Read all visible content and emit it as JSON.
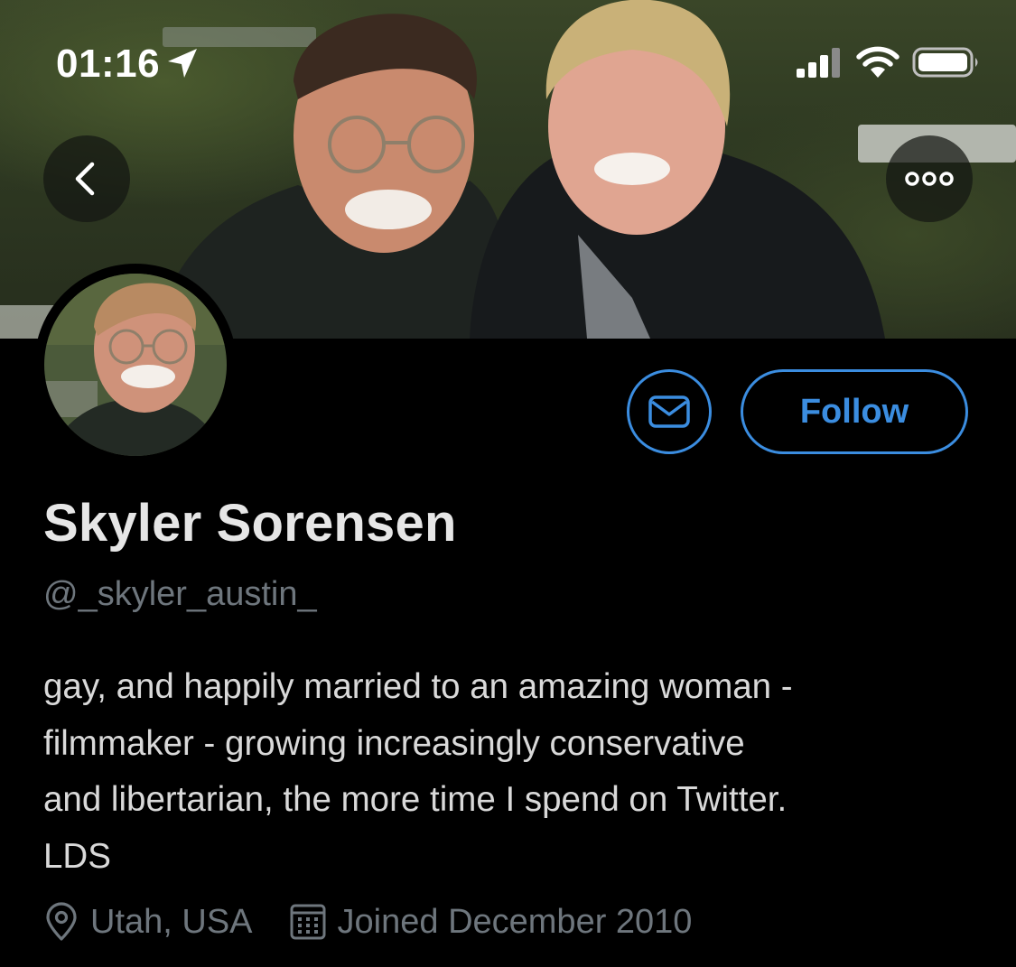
{
  "status_bar": {
    "time": "01:16",
    "location_icon": "location-arrow-icon",
    "signal_icon": "cellular-signal-icon",
    "wifi_icon": "wifi-icon",
    "battery_icon": "battery-icon"
  },
  "header": {
    "back_icon": "chevron-left-icon",
    "more_icon": "more-horizontal-icon"
  },
  "actions": {
    "message_icon": "envelope-icon",
    "follow_label": "Follow"
  },
  "profile": {
    "display_name": "Skyler Sorensen",
    "handle": "@_skyler_austin_",
    "bio_lines": [
      "gay, and happily married to an amazing woman -",
      "filmmaker - growing increasingly conservative",
      "and libertarian, the more time I spend on Twitter.",
      "LDS"
    ],
    "location": "Utah, USA",
    "joined": "Joined December 2010"
  },
  "colors": {
    "background": "#000000",
    "accent": "#3b8de0",
    "secondary_text": "#6e767d",
    "primary_text": "#d9d9d9"
  }
}
